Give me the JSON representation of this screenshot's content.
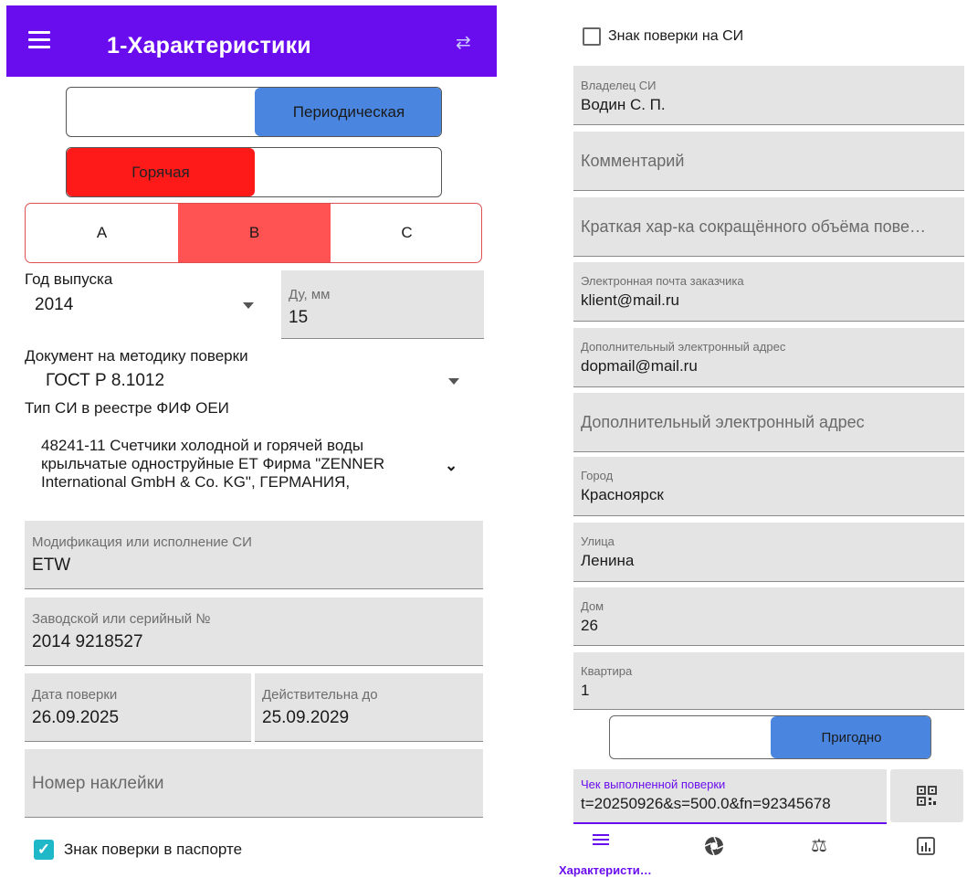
{
  "left": {
    "title": "1-Характеристики",
    "seg_type": {
      "left": "",
      "right": "Периодическая"
    },
    "seg_water": {
      "left": "Горячая",
      "right": ""
    },
    "seg_class": [
      "A",
      "B",
      "C"
    ],
    "year": {
      "label": "Год выпуска",
      "value": "2014"
    },
    "du": {
      "label": "Ду, мм",
      "value": "15"
    },
    "method_doc": {
      "label": "Документ на методику поверки",
      "value": "ГОСТ Р 8.1012"
    },
    "si_type": {
      "label": "Тип СИ в реестре ФИФ ОЕИ",
      "value_lines": [
        "48241-11 Счетчики холодной и горячей воды",
        "крыльчатые одноструйные ЕТ Фирма \"ZENNER",
        "International GmbH & Co. KG\", ГЕРМАНИЯ,"
      ]
    },
    "modification": {
      "label": "Модификация или исполнение СИ",
      "value": "ETW"
    },
    "serial": {
      "label": "Заводской или серийный №",
      "value": "2014 9218527"
    },
    "verify_date": {
      "label": "Дата поверки",
      "value": "26.09.2025"
    },
    "valid_until": {
      "label": "Действительна до",
      "value": "25.09.2029"
    },
    "sticker": {
      "placeholder": "Номер наклейки"
    },
    "passport_mark": {
      "label": "Знак поверки в паспорте",
      "checked": true
    }
  },
  "right": {
    "si_mark": {
      "label": "Знак поверки на СИ",
      "checked": false
    },
    "owner": {
      "label": "Владелец СИ",
      "value": "Водин С. П."
    },
    "comment": {
      "placeholder": "Комментарий"
    },
    "short_desc": {
      "placeholder": "Краткая хар-ка сокращённого объёма пове…"
    },
    "email": {
      "label": "Электронная почта заказчика",
      "value": "klient@mail.ru"
    },
    "extra_email": {
      "label": "Дополнительный электронный адрес",
      "value": "dopmail@mail.ru"
    },
    "extra_email2": {
      "placeholder": "Дополнительный электронный адрес"
    },
    "city": {
      "label": "Город",
      "value": "Красноярск"
    },
    "street": {
      "label": "Улица",
      "value": "Ленина"
    },
    "house": {
      "label": "Дом",
      "value": "26"
    },
    "apartment": {
      "label": "Квартира",
      "value": "1"
    },
    "seg_result": {
      "left": "",
      "right": "Пригодно"
    },
    "receipt": {
      "label": "Чек выполненной поверки",
      "value": "t=20250926&s=500.0&fn=92345678"
    },
    "nav": {
      "active_label": "Характеристи…"
    }
  },
  "colors": {
    "primary": "#6a0dee",
    "blue": "#4a86e0",
    "red": "#ff1a1a",
    "red_light": "#ff5252",
    "check": "#1fb8c9"
  }
}
